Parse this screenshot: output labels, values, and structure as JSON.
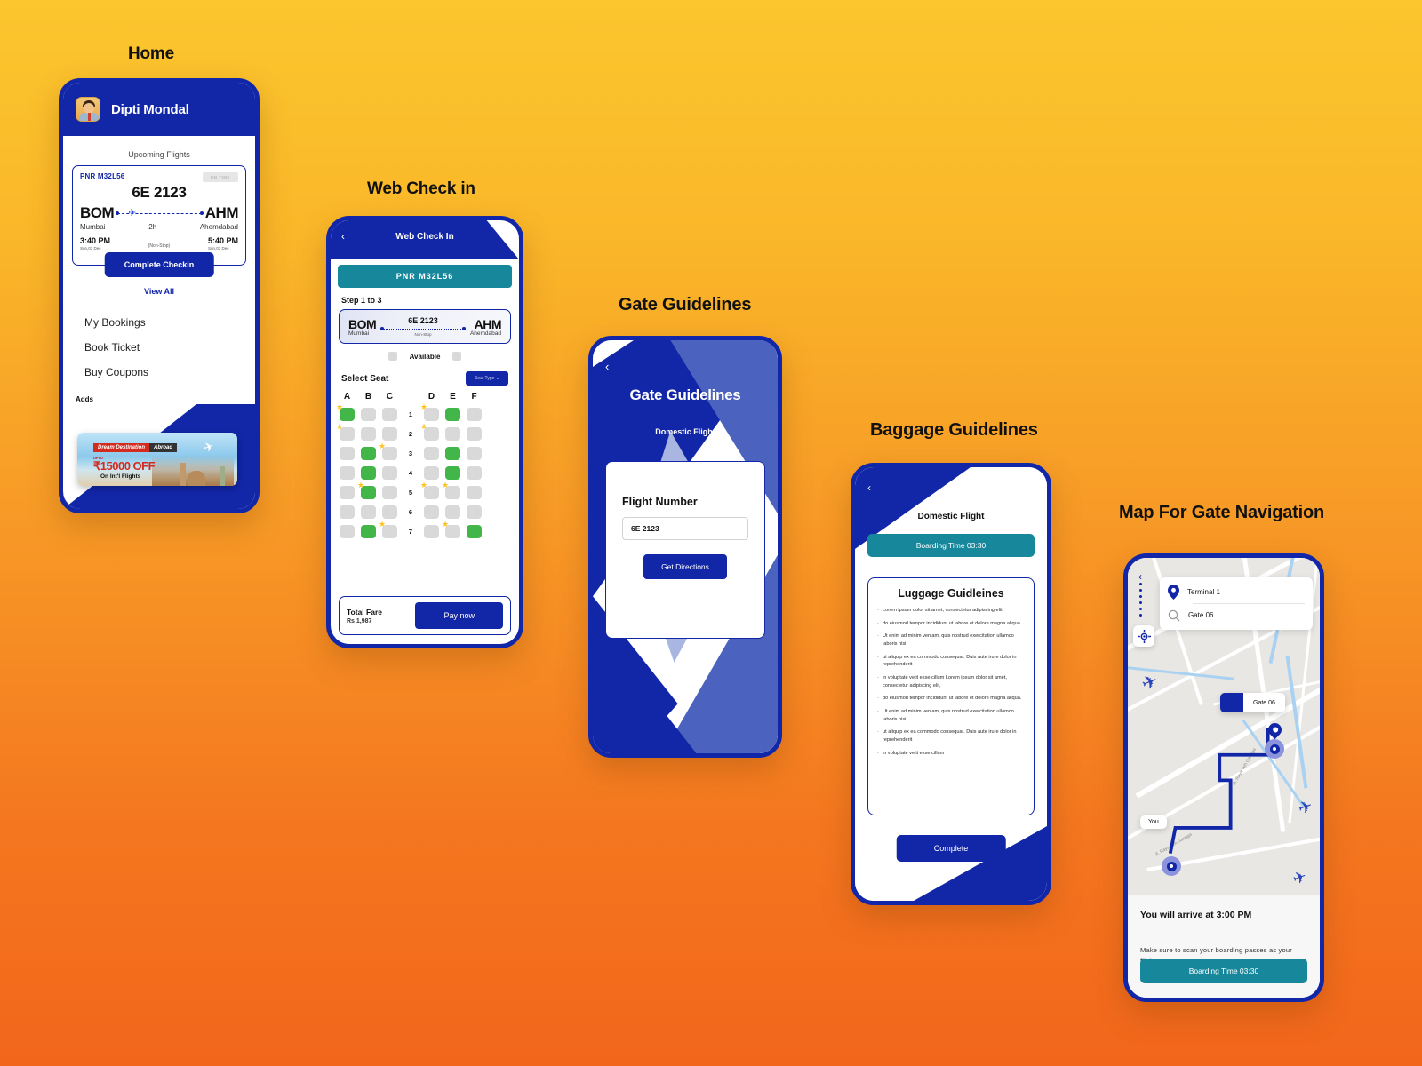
{
  "captions": {
    "home": "Home",
    "web_check_in": "Web Check in",
    "gate_guidelines": "Gate Guidelines",
    "baggage_guidelines": "Baggage Guidelines",
    "map_for_gate_navigation": "Map For Gate Navigation"
  },
  "colors": {
    "brand_navy": "#1226A8",
    "teal": "#17889C",
    "seat_selected_green": "#43B649",
    "seat_available_gray": "#D9D9D9",
    "star_yellow": "#FFC21F",
    "bg_gradient_top": "#FBC62E",
    "bg_gradient_bottom": "#F2661B"
  },
  "home": {
    "user_name": "Dipti Mondal",
    "upcoming_label": "Upcoming Flights",
    "flight_card": {
      "pnr": "PNR M32L56",
      "status_badge": "ON TIME",
      "flight_number": "6E 2123",
      "origin_code": "BOM",
      "origin_city": "Mumbai",
      "destination_code": "AHM",
      "destination_city": "Ahemdabad",
      "duration": "2h",
      "stops": "(Non-Stop)",
      "depart_time": "3:40 PM",
      "depart_date": "Sun,03 Dec",
      "arrive_time": "5:40 PM",
      "arrive_date": "Sun,03 Dec",
      "cta": "Complete Checkin"
    },
    "view_all": "View All",
    "menu": [
      "My Bookings",
      "Book Ticket",
      "Buy Coupons"
    ],
    "adds_label": "Adds",
    "ad": {
      "ribbon_left": "Dream Destination",
      "ribbon_right": "Abroad",
      "upto": "UPTO",
      "amount": "₹15000 OFF",
      "subtitle": "On Int'l Flights"
    }
  },
  "web_check_in": {
    "title": "Web Check In",
    "back_icon": "chevron-left",
    "pnr_banner": "PNR   M32L56",
    "step_label": "Step 1 to 3",
    "route": {
      "origin_code": "BOM",
      "origin_city": "Mumbai",
      "flight_number": "6E 2123",
      "stops": "Non-Stop",
      "destination_code": "AHM",
      "destination_city": "Ahemdabad"
    },
    "legend_label": "Available",
    "select_seat_label": "Select Seat",
    "seat_type_button": "Seat Type",
    "columns_left": [
      "A",
      "B",
      "C"
    ],
    "columns_right": [
      "D",
      "E",
      "F"
    ],
    "rows": [
      "1",
      "2",
      "3",
      "4",
      "5",
      "6",
      "7"
    ],
    "seat_grid": [
      {
        "row": "1",
        "left": [
          {
            "state": "selected",
            "star": true
          },
          {
            "state": "available",
            "star": false
          },
          {
            "state": "available",
            "star": false
          }
        ],
        "right": [
          {
            "state": "available",
            "star": true
          },
          {
            "state": "selected",
            "star": false
          },
          {
            "state": "available",
            "star": false
          }
        ]
      },
      {
        "row": "2",
        "left": [
          {
            "state": "available",
            "star": true
          },
          {
            "state": "available",
            "star": false
          },
          {
            "state": "available",
            "star": false
          }
        ],
        "right": [
          {
            "state": "available",
            "star": true
          },
          {
            "state": "available",
            "star": false
          },
          {
            "state": "available",
            "star": false
          }
        ]
      },
      {
        "row": "3",
        "left": [
          {
            "state": "available",
            "star": false
          },
          {
            "state": "selected",
            "star": false
          },
          {
            "state": "available",
            "star": true
          }
        ],
        "right": [
          {
            "state": "available",
            "star": false
          },
          {
            "state": "selected",
            "star": false
          },
          {
            "state": "available",
            "star": false
          }
        ]
      },
      {
        "row": "4",
        "left": [
          {
            "state": "available",
            "star": false
          },
          {
            "state": "selected",
            "star": false
          },
          {
            "state": "available",
            "star": false
          }
        ],
        "right": [
          {
            "state": "available",
            "star": false
          },
          {
            "state": "selected",
            "star": false
          },
          {
            "state": "available",
            "star": false
          }
        ]
      },
      {
        "row": "5",
        "left": [
          {
            "state": "available",
            "star": false
          },
          {
            "state": "selected",
            "star": true
          },
          {
            "state": "available",
            "star": false
          }
        ],
        "right": [
          {
            "state": "available",
            "star": true
          },
          {
            "state": "available",
            "star": true
          },
          {
            "state": "available",
            "star": false
          }
        ]
      },
      {
        "row": "6",
        "left": [
          {
            "state": "available",
            "star": false
          },
          {
            "state": "available",
            "star": false
          },
          {
            "state": "available",
            "star": false
          }
        ],
        "right": [
          {
            "state": "available",
            "star": false
          },
          {
            "state": "available",
            "star": false
          },
          {
            "state": "available",
            "star": false
          }
        ]
      },
      {
        "row": "7",
        "left": [
          {
            "state": "available",
            "star": false
          },
          {
            "state": "selected",
            "star": false
          },
          {
            "state": "available",
            "star": true
          }
        ],
        "right": [
          {
            "state": "available",
            "star": false
          },
          {
            "state": "available",
            "star": true
          },
          {
            "state": "selected",
            "star": false
          }
        ]
      }
    ],
    "total_fare_label": "Total Fare",
    "total_fare_value": "Rs 1,987",
    "pay_button": "Pay now"
  },
  "gate_guidelines": {
    "back_icon": "chevron-left",
    "title": "Gate Guidelines",
    "subtitle": "Domestic Flight",
    "flight_number_label": "Flight Number",
    "flight_number_value": "6E 2123",
    "cta": "Get Directions"
  },
  "baggage_guidelines": {
    "back_icon": "chevron-left",
    "header": "Domestic Flight",
    "boarding_banner": "Boarding Time  03:30",
    "card_title": "Luggage Guidleines",
    "bullets": [
      "Lorem ipsum dolor sit amet, consectetur adipiscing elit,",
      "do eiusmod tempor incididunt ut labore et dolore magna aliqua.",
      "Ut enim ad minim veniam, quis nostrud exercitation ullamco laboris nisi",
      "ut aliquip ex ea commodo consequat. Duis aute irure dolor in reprehenderit",
      "in voluptate velit esse cillum Lorem ipsum dolor sit amet, consectetur adipiscing elit,",
      "do eiusmod tempor incididunt ut labore et dolore magna aliqua.",
      "Ut enim ad minim veniam, quis nostrud exercitation ullamco laboris nisi",
      "ut aliquip ex ea commodo consequat. Duis aute irure dolor in reprehenderit",
      "in voluptate velit esse cillum"
    ],
    "cta": "Complete"
  },
  "map_nav": {
    "back_icon": "chevron-left",
    "origin": "Terminal 1",
    "destination": "Gate 06",
    "origin_icon": "map-pin-icon",
    "destination_icon": "search-icon",
    "gate_chip_label": "Gate 06",
    "you_chip_label": "You",
    "street_labels": [
      "Jl. Raya Yeh Gangga",
      "Jl. Raya Yeh Gangga"
    ],
    "arrival_text": "You will arrive at 3:00 PM",
    "note": "Make sure to scan your boarding passes as your flight announcements are made.",
    "boarding_banner": "Boarding Time  03:30"
  }
}
